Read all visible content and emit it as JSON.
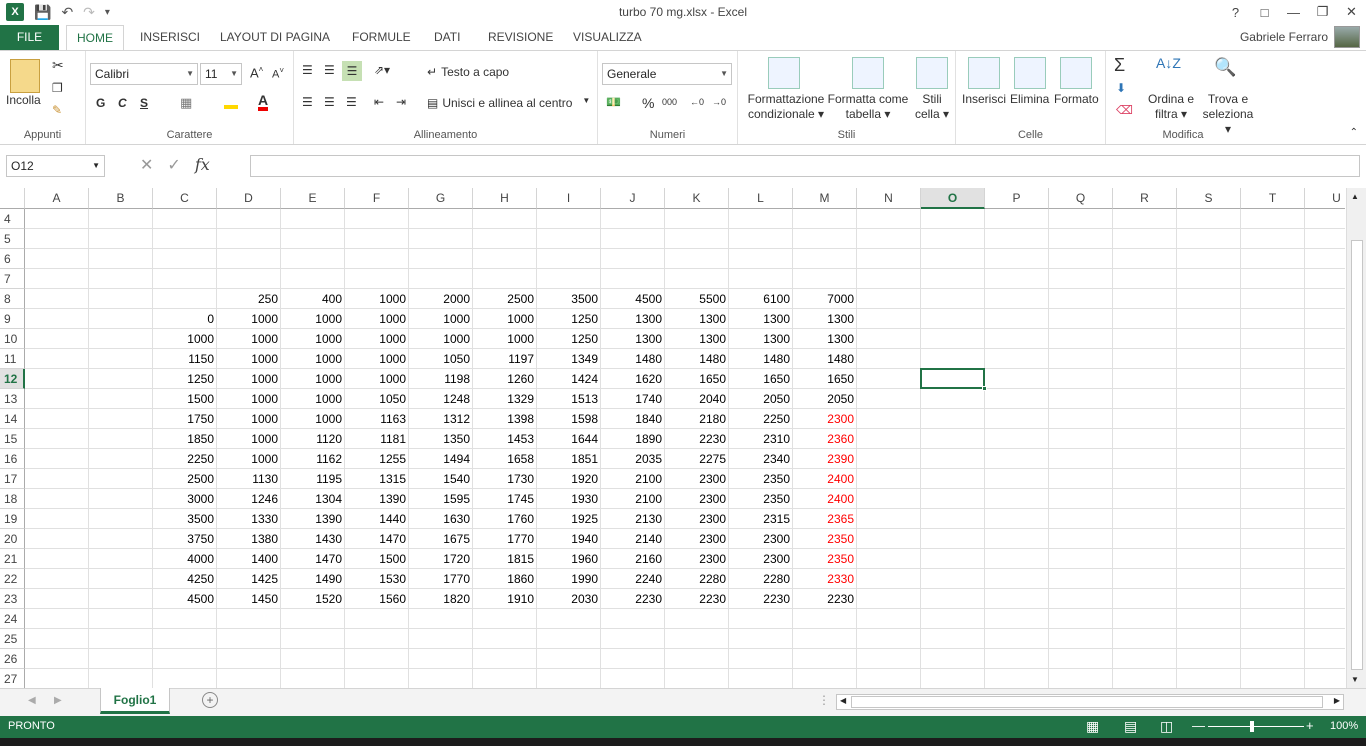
{
  "window": {
    "title": "turbo 70 mg.xlsx - Excel",
    "user_name": "Gabriele Ferraro",
    "help": "?"
  },
  "tabs": [
    "FILE",
    "HOME",
    "INSERISCI",
    "LAYOUT DI PAGINA",
    "FORMULE",
    "DATI",
    "REVISIONE",
    "VISUALIZZA"
  ],
  "ribbon": {
    "clipboard": {
      "paste": "Incolla",
      "label": "Appunti"
    },
    "font": {
      "name": "Calibri",
      "size": "11",
      "bold": "G",
      "italic": "C",
      "underline": "S",
      "label": "Carattere"
    },
    "alignment": {
      "wrap": "Testo a capo",
      "merge": "Unisci e allinea al centro",
      "label": "Allineamento"
    },
    "number": {
      "format": "Generale",
      "percent": "%",
      "thousands": "000",
      "label": "Numeri"
    },
    "styles": {
      "conditional_1": "Formattazione",
      "conditional_2": "condizionale",
      "table_1": "Formatta come",
      "table_2": "tabella",
      "cell_1": "Stili",
      "cell_2": "cella",
      "label": "Stili"
    },
    "cells": {
      "insert": "Inserisci",
      "delete": "Elimina",
      "format": "Formato",
      "label": "Celle"
    },
    "editing": {
      "sort_1": "Ordina e",
      "sort_2": "filtra",
      "find_1": "Trova e",
      "find_2": "seleziona",
      "label": "Modifica"
    }
  },
  "formula_bar": {
    "name_box": "O12",
    "fx": "fx",
    "value": ""
  },
  "sheet": {
    "columns": [
      "A",
      "B",
      "C",
      "D",
      "E",
      "F",
      "G",
      "H",
      "I",
      "J",
      "K",
      "L",
      "M",
      "N",
      "O",
      "P",
      "Q",
      "R",
      "S",
      "T",
      "U"
    ],
    "rows": [
      "4",
      "5",
      "6",
      "7",
      "8",
      "9",
      "10",
      "11",
      "12",
      "13",
      "14",
      "15",
      "16",
      "17",
      "18",
      "19",
      "20",
      "21",
      "22",
      "23",
      "24",
      "25",
      "26",
      "27"
    ],
    "selected_cell": "O12",
    "header_row": [
      "",
      "250",
      "400",
      "1000",
      "2000",
      "2500",
      "3500",
      "4500",
      "5500",
      "6100",
      "7000"
    ],
    "data_rows": [
      [
        "0",
        "1000",
        "1000",
        "1000",
        "1000",
        "1000",
        "1250",
        "1300",
        "1300",
        "1300",
        "1300"
      ],
      [
        "1000",
        "1000",
        "1000",
        "1000",
        "1000",
        "1000",
        "1250",
        "1300",
        "1300",
        "1300",
        "1300"
      ],
      [
        "1150",
        "1000",
        "1000",
        "1000",
        "1050",
        "1197",
        "1349",
        "1480",
        "1480",
        "1480",
        "1480"
      ],
      [
        "1250",
        "1000",
        "1000",
        "1000",
        "1198",
        "1260",
        "1424",
        "1620",
        "1650",
        "1650",
        "1650"
      ],
      [
        "1500",
        "1000",
        "1000",
        "1050",
        "1248",
        "1329",
        "1513",
        "1740",
        "2040",
        "2050",
        "2050"
      ],
      [
        "1750",
        "1000",
        "1000",
        "1163",
        "1312",
        "1398",
        "1598",
        "1840",
        "2180",
        "2250",
        "2300"
      ],
      [
        "1850",
        "1000",
        "1120",
        "1181",
        "1350",
        "1453",
        "1644",
        "1890",
        "2230",
        "2310",
        "2360"
      ],
      [
        "2250",
        "1000",
        "1162",
        "1255",
        "1494",
        "1658",
        "1851",
        "2035",
        "2275",
        "2340",
        "2390"
      ],
      [
        "2500",
        "1130",
        "1195",
        "1315",
        "1540",
        "1730",
        "1920",
        "2100",
        "2300",
        "2350",
        "2400"
      ],
      [
        "3000",
        "1246",
        "1304",
        "1390",
        "1595",
        "1745",
        "1930",
        "2100",
        "2300",
        "2350",
        "2400"
      ],
      [
        "3500",
        "1330",
        "1390",
        "1440",
        "1630",
        "1760",
        "1925",
        "2130",
        "2300",
        "2315",
        "2365"
      ],
      [
        "3750",
        "1380",
        "1430",
        "1470",
        "1675",
        "1770",
        "1940",
        "2140",
        "2300",
        "2300",
        "2350"
      ],
      [
        "4000",
        "1400",
        "1470",
        "1500",
        "1720",
        "1815",
        "1960",
        "2160",
        "2300",
        "2300",
        "2350"
      ],
      [
        "4250",
        "1425",
        "1490",
        "1530",
        "1770",
        "1860",
        "1990",
        "2240",
        "2280",
        "2280",
        "2330"
      ],
      [
        "4500",
        "1450",
        "1520",
        "1560",
        "1820",
        "1910",
        "2030",
        "2230",
        "2230",
        "2230",
        "2230"
      ]
    ],
    "red_color": "#ff0000",
    "red_from_row_index": 5,
    "red_until_row_index": 13
  },
  "sheet_tabs": [
    "Foglio1"
  ],
  "status": {
    "mode": "PRONTO",
    "zoom": "100%"
  },
  "colors": {
    "accent": "#217346"
  }
}
